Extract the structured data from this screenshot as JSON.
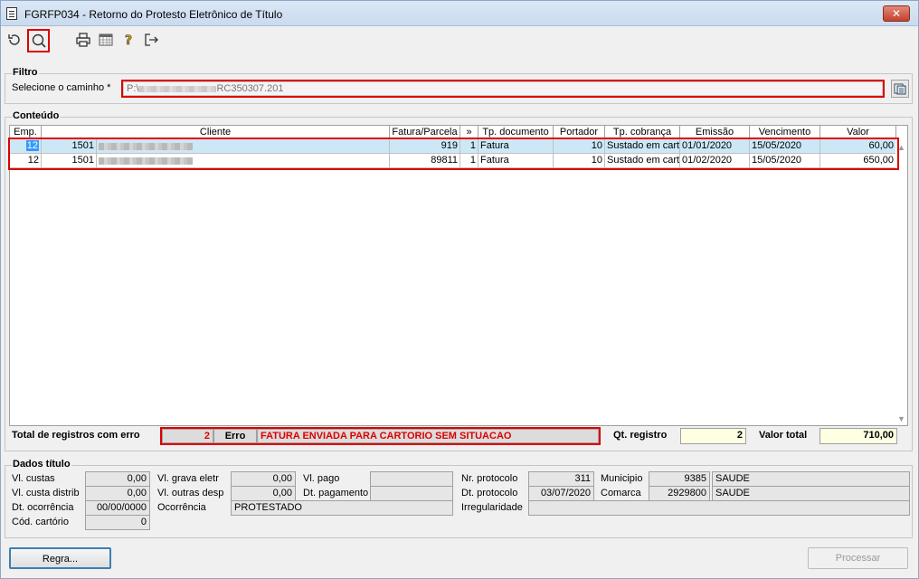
{
  "window": {
    "title": "FGRFP034 - Retorno do Protesto Eletrônico de Título",
    "close_label": "✕"
  },
  "toolbar": {
    "icons": [
      "refresh-icon",
      "search-icon",
      "print-icon",
      "calendar-grid-icon",
      "help-icon",
      "exit-icon"
    ]
  },
  "filtro": {
    "group_label": "Filtro",
    "caminho_label": "Selecione o caminho *",
    "caminho_value_prefix": "P:\\",
    "caminho_value_suffix": "RC350307.201"
  },
  "conteudo": {
    "group_label": "Conteúdo",
    "columns": [
      "Emp.",
      "Cliente",
      "Fatura/Parcela",
      "»",
      "Tp. documento",
      "Portador",
      "Tp. cobrança",
      "Emissão",
      "Vencimento",
      "Valor"
    ],
    "rows": [
      {
        "emp": "12",
        "cliente_cod": "1501",
        "fatura": "919",
        "parcela": "1",
        "tp_documento": "Fatura",
        "portador": "10",
        "tp_cobranca": "Sustado em cartório",
        "emissao": "01/01/2020",
        "vencimento": "15/05/2020",
        "valor": "60,00"
      },
      {
        "emp": "12",
        "cliente_cod": "1501",
        "fatura": "89811",
        "parcela": "1",
        "tp_documento": "Fatura",
        "portador": "10",
        "tp_cobranca": "Sustado em cartório",
        "emissao": "01/02/2020",
        "vencimento": "15/05/2020",
        "valor": "650,00"
      }
    ],
    "total_erro_label": "Total de registros com erro",
    "total_erro_value": "2",
    "erro_label": "Erro",
    "erro_message": "FATURA ENVIADA PARA CARTORIO SEM SITUACAO",
    "qt_registro_label": "Qt. registro",
    "qt_registro_value": "2",
    "valor_total_label": "Valor total",
    "valor_total_value": "710,00"
  },
  "dados": {
    "group_label": "Dados título",
    "vl_custas_label": "Vl. custas",
    "vl_custas": "0,00",
    "vl_custa_distrib_label": "Vl. custa distrib",
    "vl_custa_distrib": "0,00",
    "dt_ocorrencia_label": "Dt. ocorrência",
    "dt_ocorrencia": "00/00/0000",
    "cod_cartorio_label": "Cód. cartório",
    "cod_cartorio": "0",
    "vl_grava_eletr_label": "Vl. grava eletr",
    "vl_grava_eletr": "0,00",
    "vl_outras_desp_label": "Vl. outras desp",
    "vl_outras_desp": "0,00",
    "ocorrencia_label": "Ocorrência",
    "ocorrencia": "PROTESTADO",
    "vl_pago_label": "Vl. pago",
    "vl_pago": "",
    "dt_pagamento_label": "Dt. pagamento",
    "dt_pagamento": "",
    "nr_protocolo_label": "Nr. protocolo",
    "nr_protocolo": "311",
    "dt_protocolo_label": "Dt. protocolo",
    "dt_protocolo": "03/07/2020",
    "irregularidade_label": "Irregularidade",
    "irregularidade": "",
    "municipio_label": "Municipio",
    "municipio_cod": "9385",
    "municipio_nome": "SAUDE",
    "comarca_label": "Comarca",
    "comarca_cod": "2929800",
    "comarca_nome": "SAUDE"
  },
  "buttons": {
    "regra": "Regra...",
    "processar": "Processar"
  }
}
